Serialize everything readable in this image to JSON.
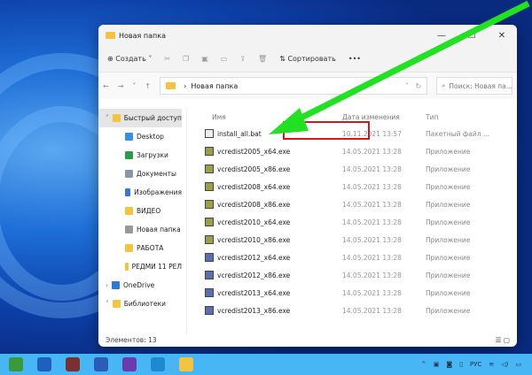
{
  "window": {
    "title": "Новая папка"
  },
  "toolbar": {
    "create": "Создать",
    "sort": "Сортировать",
    "more": "•••"
  },
  "address": {
    "path": "Новая папка",
    "search_placeholder": "Поиск: Новая па..."
  },
  "nav": [
    {
      "label": "Быстрый доступ",
      "color": "#f5c342"
    },
    {
      "label": "Desktop",
      "color": "#3a8ee6"
    },
    {
      "label": "Загрузки",
      "color": "#2a9d4a"
    },
    {
      "label": "Документы",
      "color": "#8a96a8"
    },
    {
      "label": "Изображения",
      "color": "#3a78d0"
    },
    {
      "label": "ВИДЕО",
      "color": "#f5c342"
    },
    {
      "label": "Новая папка",
      "color": "#999999"
    },
    {
      "label": "РАБОТА",
      "color": "#f5c342"
    },
    {
      "label": "РЕДМИ 11 РЕЛ",
      "color": "#f5c342"
    },
    {
      "label": "OneDrive",
      "color": "#2a7ad8"
    },
    {
      "label": "Библиотеки",
      "color": "#f5c342"
    }
  ],
  "columns": {
    "name": "Имя",
    "date": "Дата изменения",
    "type": "Тип"
  },
  "files": [
    {
      "name": "install_all.bat",
      "date": "10.11.2021 13:57",
      "type": "Пакетный файл ..."
    },
    {
      "name": "vcredist2005_x64.exe",
      "date": "14.05.2021 13:28",
      "type": "Приложение"
    },
    {
      "name": "vcredist2005_x86.exe",
      "date": "14.05.2021 13:28",
      "type": "Приложение"
    },
    {
      "name": "vcredist2008_x64.exe",
      "date": "14.05.2021 13:28",
      "type": "Приложение"
    },
    {
      "name": "vcredist2008_x86.exe",
      "date": "14.05.2021 13:28",
      "type": "Приложение"
    },
    {
      "name": "vcredist2010_x64.exe",
      "date": "14.05.2021 13:28",
      "type": "Приложение"
    },
    {
      "name": "vcredist2010_x86.exe",
      "date": "14.05.2021 13:28",
      "type": "Приложение"
    },
    {
      "name": "vcredist2012_x64.exe",
      "date": "14.05.2021 13:28",
      "type": "Приложение"
    },
    {
      "name": "vcredist2012_x86.exe",
      "date": "14.05.2021 13:28",
      "type": "Приложение"
    },
    {
      "name": "vcredist2013_x64.exe",
      "date": "14.05.2021 13:28",
      "type": "Приложение"
    },
    {
      "name": "vcredist2013_x86.exe",
      "date": "14.05.2021 13:28",
      "type": "Приложение"
    }
  ],
  "status": "Элементов: 13",
  "taskbar": {
    "lang": "РУС",
    "apps": [
      "#3a9a3a",
      "#1e5fc0",
      "#7a3030",
      "#2b5cb8",
      "#6a3ab0",
      "#1e88d0",
      "#f5c342"
    ]
  }
}
